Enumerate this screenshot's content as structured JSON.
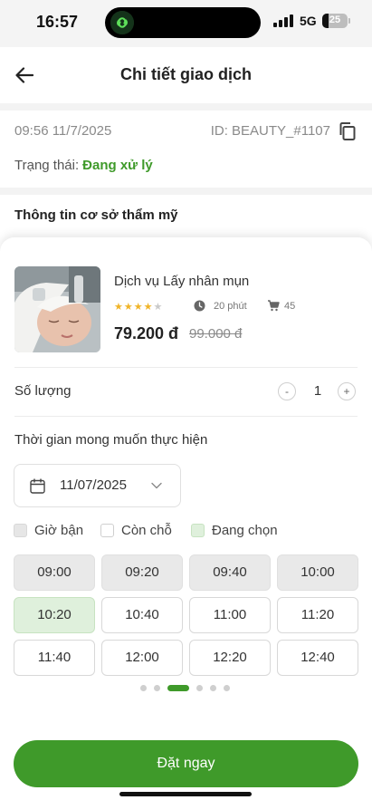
{
  "status_bar": {
    "time": "16:57",
    "network": "5G",
    "battery_level": "25",
    "battery_fraction": 0.25
  },
  "header": {
    "title": "Chi tiết giao dịch",
    "back_icon": "arrow-left-icon"
  },
  "transaction": {
    "datetime": "09:56 11/7/2025",
    "id": "ID: BEAUTY_#1107",
    "copy_icon": "copy-icon",
    "status_label": "Trạng thái:",
    "status_value": "Đang xử lý",
    "section_title": "Thông tin cơ sở thẩm mỹ"
  },
  "service": {
    "name": "Dịch vụ Lấy nhân mụn",
    "rating": 4,
    "rating_max": 5,
    "duration": "20 phút",
    "sold": "45",
    "price": "79.200 đ",
    "old_price": "99.000 đ"
  },
  "quantity": {
    "label": "Số lượng",
    "minus": "-",
    "value": "1",
    "plus": "+"
  },
  "schedule": {
    "label": "Thời gian mong muốn thực hiện",
    "date": "11/07/2025",
    "legend": [
      "Giờ bận",
      "Còn chỗ",
      "Đang chọn"
    ],
    "slots": [
      {
        "time": "09:00",
        "state": "busy"
      },
      {
        "time": "09:20",
        "state": "busy"
      },
      {
        "time": "09:40",
        "state": "busy"
      },
      {
        "time": "10:00",
        "state": "busy"
      },
      {
        "time": "10:20",
        "state": "selected"
      },
      {
        "time": "10:40",
        "state": "available"
      },
      {
        "time": "11:00",
        "state": "available"
      },
      {
        "time": "11:20",
        "state": "available"
      },
      {
        "time": "11:40",
        "state": "available"
      },
      {
        "time": "12:00",
        "state": "available"
      },
      {
        "time": "12:20",
        "state": "available"
      },
      {
        "time": "12:40",
        "state": "available"
      }
    ],
    "pages": 6,
    "current_page": 3
  },
  "cta": {
    "book_label": "Đặt ngay"
  },
  "colors": {
    "accent": "#3f9a2a",
    "busy": "#e9e9e9",
    "selected": "#dff0dc",
    "star": "#f0b428"
  }
}
